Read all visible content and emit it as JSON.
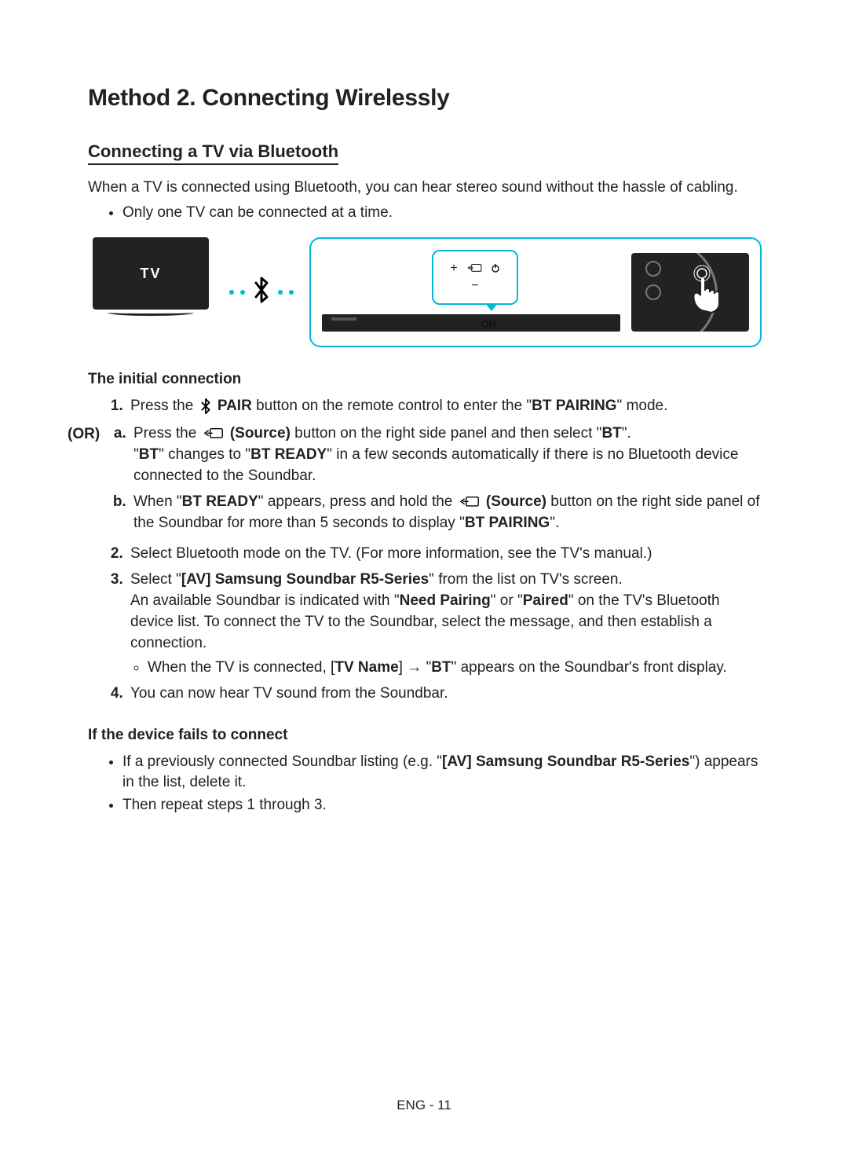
{
  "title": "Method 2. Connecting Wirelessly",
  "subtitle": "Connecting a TV via Bluetooth",
  "intro": "When a TV is connected using Bluetooth, you can hear stereo sound without the hassle of cabling.",
  "bullet1": "Only one TV can be connected at a time.",
  "diagram": {
    "tv_label": "TV",
    "or_label": "OR"
  },
  "initial_title": "The initial connection",
  "or_tag": "(OR)",
  "step1_a": "Press the ",
  "step1_pair": " PAIR",
  "step1_b": " button on the remote control to enter the \"",
  "step1_c": "BT PAIRING",
  "step1_d": "\" mode.",
  "sub_a_1": "Press the ",
  "sub_a_src": " (Source)",
  "sub_a_2": " button on the right side panel and then select \"",
  "sub_a_bt": "BT",
  "sub_a_3": "\".",
  "sub_a_line2_a": "\"",
  "sub_a_line2_b": "BT",
  "sub_a_line2_c": "\" changes to \"",
  "sub_a_line2_d": "BT READY",
  "sub_a_line2_e": "\" in a few seconds automatically if there is no Bluetooth device connected to the Soundbar.",
  "sub_b_1": "When \"",
  "sub_b_2": "BT READY",
  "sub_b_3": "\" appears, press and hold the ",
  "sub_b_src": " (Source)",
  "sub_b_4": " button on the right side panel of the Soundbar for more than 5 seconds to display \"",
  "sub_b_5": "BT PAIRING",
  "sub_b_6": "\".",
  "step2": "Select Bluetooth mode on the TV. (For more information, see the TV's manual.)",
  "step3_a": "Select \"",
  "step3_b": "[AV] Samsung Soundbar R5-Series",
  "step3_c": "\" from the list on TV's screen.",
  "step3_line2_a": "An available Soundbar is indicated with \"",
  "step3_line2_b": "Need Pairing",
  "step3_line2_c": "\" or \"",
  "step3_line2_d": "Paired",
  "step3_line2_e": "\" on the TV's Bluetooth device list. To connect the TV to the Soundbar, select the message, and then establish a connection.",
  "step3_bullet_a": "When the TV is connected, [",
  "step3_bullet_b": "TV Name",
  "step3_bullet_c": "] → \"",
  "step3_bullet_d": "BT",
  "step3_bullet_e": "\" appears on the Soundbar's front display.",
  "step4": "You can now hear TV sound from the Soundbar.",
  "fail_title": "If the device fails to connect",
  "fail_b1_a": "If a previously connected Soundbar listing (e.g. \"",
  "fail_b1_b": "[AV] Samsung Soundbar R5-Series",
  "fail_b1_c": "\") appears in the list, delete it.",
  "fail_b2": "Then repeat steps 1 through 3.",
  "footer": "ENG - 11"
}
